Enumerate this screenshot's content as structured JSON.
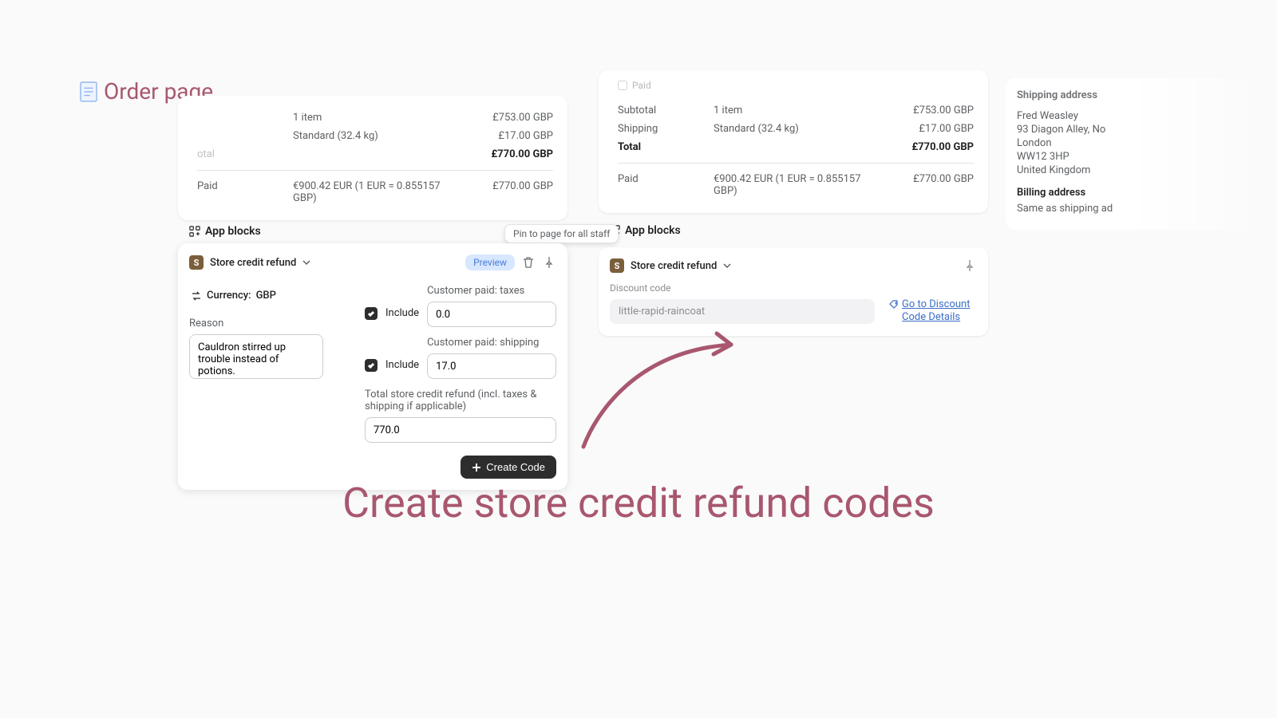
{
  "page_title": "Order page",
  "hero": "Create store credit refund codes",
  "app_blocks_label": "App blocks",
  "tooltip": "Pin to page for all staff",
  "left_summary": {
    "total_label_faded": "otal",
    "items": "1 item",
    "items_price": "£753.00 GBP",
    "shipping_desc": "Standard (32.4 kg)",
    "shipping_price": "£17.00 GBP",
    "total_price": "£770.00 GBP",
    "paid_label": "Paid",
    "paid_amount": "€900.42 EUR (1 EUR = 0.855157 GBP)",
    "paid_right": "£770.00 GBP"
  },
  "right_summary": {
    "paid_chip": "Paid",
    "subtotal_label": "Subtotal",
    "items": "1 item",
    "items_price": "£753.00 GBP",
    "shipping_label": "Shipping",
    "shipping_desc": "Standard (32.4 kg)",
    "shipping_price": "£17.00 GBP",
    "total_label": "Total",
    "total_price": "£770.00 GBP",
    "paid_label": "Paid",
    "paid_amount": "€900.42 EUR (1 EUR = 0.855157 GBP)",
    "paid_right": "£770.00 GBP"
  },
  "shipping": {
    "heading": "Shipping address",
    "name": "Fred Weasley",
    "line1": "93 Diagon Alley, No",
    "city": "London",
    "postcode": "WW12 3HP",
    "country": "United Kingdom",
    "billing_heading": "Billing address",
    "billing_text": "Same as shipping ad"
  },
  "left_app": {
    "title": "Store credit refund",
    "preview": "Preview",
    "currency_label": "Currency:",
    "currency_value": "GBP",
    "reason_label": "Reason",
    "reason_value": "Cauldron stirred up trouble instead of potions.",
    "include_label": "Include",
    "taxes_label": "Customer paid: taxes",
    "taxes_value": "0.0",
    "shipping_label": "Customer paid: shipping",
    "shipping_value": "17.0",
    "total_label": "Total store credit refund (incl. taxes & shipping if applicable)",
    "total_value": "770.0",
    "create_label": "Create Code"
  },
  "right_app": {
    "title": "Store credit refund",
    "discount_label": "Discount code",
    "discount_value": "little-rapid-raincoat",
    "link_text": "Go to Discount Code Details"
  }
}
